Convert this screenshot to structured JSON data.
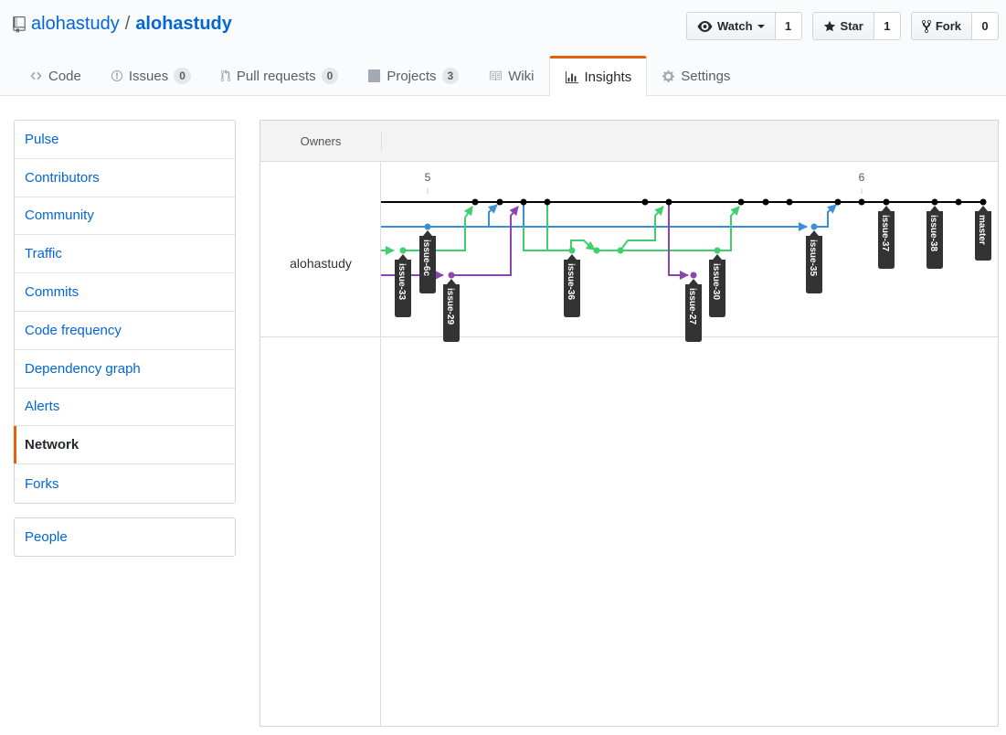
{
  "repo": {
    "owner": "alohastudy",
    "separator": "/",
    "name": "alohastudy",
    "icon": "repo-icon"
  },
  "actions": {
    "watch": {
      "label": "Watch",
      "count": "1",
      "icon": "eye-icon"
    },
    "star": {
      "label": "Star",
      "count": "1",
      "icon": "star-icon"
    },
    "fork": {
      "label": "Fork",
      "count": "0",
      "icon": "fork-icon"
    }
  },
  "tabs": [
    {
      "label": "Code",
      "icon": "code-icon"
    },
    {
      "label": "Issues",
      "count": "0",
      "icon": "issue-icon"
    },
    {
      "label": "Pull requests",
      "count": "0",
      "icon": "pull-request-icon"
    },
    {
      "label": "Projects",
      "count": "3",
      "icon": "project-icon"
    },
    {
      "label": "Wiki",
      "icon": "book-icon"
    },
    {
      "label": "Insights",
      "icon": "graph-icon",
      "selected": true
    },
    {
      "label": "Settings",
      "icon": "gear-icon"
    }
  ],
  "sidebar": {
    "items": [
      {
        "label": "Pulse"
      },
      {
        "label": "Contributors"
      },
      {
        "label": "Community"
      },
      {
        "label": "Traffic"
      },
      {
        "label": "Commits"
      },
      {
        "label": "Code frequency"
      },
      {
        "label": "Dependency graph"
      },
      {
        "label": "Alerts"
      },
      {
        "label": "Network",
        "selected": true
      },
      {
        "label": "Forks"
      }
    ],
    "people": "People"
  },
  "network": {
    "owners_header": "Owners",
    "owner": "alohastudy",
    "dates": [
      "5",
      "6"
    ],
    "colors": {
      "master": "#000000",
      "blue": "#3b8fd6",
      "green": "#3fcf6f",
      "purple": "#8e44ad",
      "label_bg": "#333333"
    },
    "branches": [
      "issue-33",
      "issue-6c",
      "issue-29",
      "issue-36",
      "issue-27",
      "issue-30",
      "issue-35",
      "issue-37",
      "issue-38",
      "master"
    ]
  }
}
